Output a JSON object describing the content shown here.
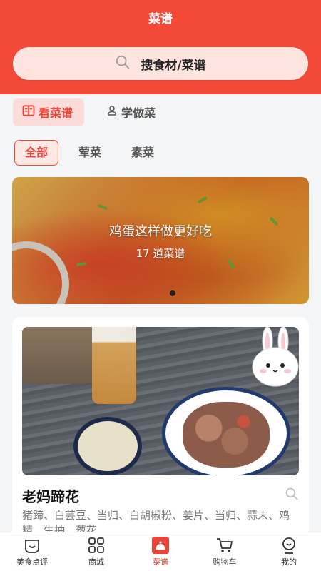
{
  "header": {
    "title": "菜谱"
  },
  "search": {
    "placeholder": "搜食材/菜谱",
    "icon": "search-icon"
  },
  "segments": [
    {
      "label": "看菜谱",
      "icon": "recipe-book-icon",
      "active": true
    },
    {
      "label": "学做菜",
      "icon": "chef-icon",
      "active": false
    }
  ],
  "filters": [
    {
      "label": "全部",
      "active": true
    },
    {
      "label": "荤菜",
      "active": false
    },
    {
      "label": "素菜",
      "active": false
    }
  ],
  "banner": {
    "title": "鸡蛋这样做更好吃",
    "subtitle": "17 道菜谱"
  },
  "card": {
    "title": "老妈蹄花",
    "description": "猪蹄、白芸豆、当归、白胡椒粉、姜片、当归、蒜末、鸡精、生抽、葱花"
  },
  "tabbar": [
    {
      "label": "美食点评",
      "icon": "food-review-icon",
      "active": false
    },
    {
      "label": "商城",
      "icon": "grid-icon",
      "active": false
    },
    {
      "label": "菜谱",
      "icon": "recipe-icon",
      "active": true
    },
    {
      "label": "购物车",
      "icon": "cart-icon",
      "active": false
    },
    {
      "label": "我的",
      "icon": "profile-icon",
      "active": false
    }
  ],
  "colors": {
    "brand": "#f24a37",
    "search_bg": "#fde4df",
    "active_text": "#e8453a"
  }
}
